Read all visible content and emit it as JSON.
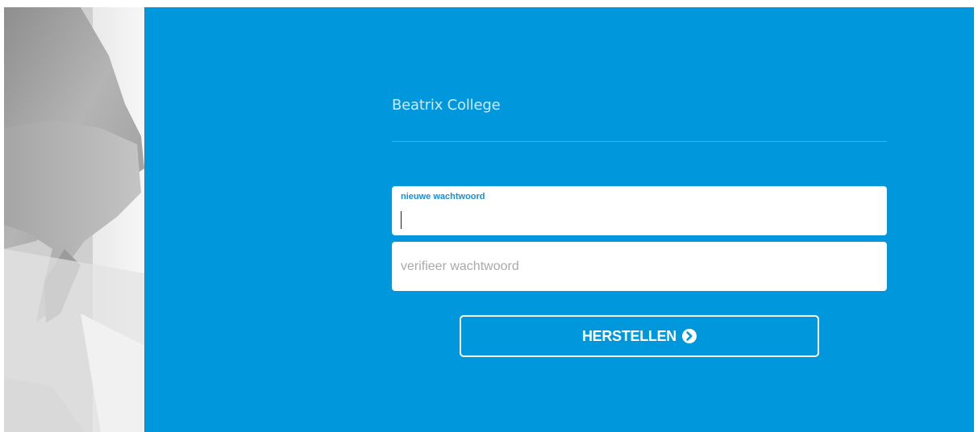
{
  "brand": {
    "name": "Beatrix College"
  },
  "form": {
    "new_password": {
      "label": "nieuwe wachtwoord",
      "value": ""
    },
    "verify_password": {
      "placeholder": "verifieer wachtwoord",
      "value": ""
    },
    "submit_label": "HERSTELLEN",
    "submit_icon": "chevron-circle-right-icon"
  },
  "colors": {
    "background": "#0097dc",
    "field_background": "#ffffff",
    "label_accent": "#1c8fcf",
    "brand_text": "#c9ecfc"
  }
}
